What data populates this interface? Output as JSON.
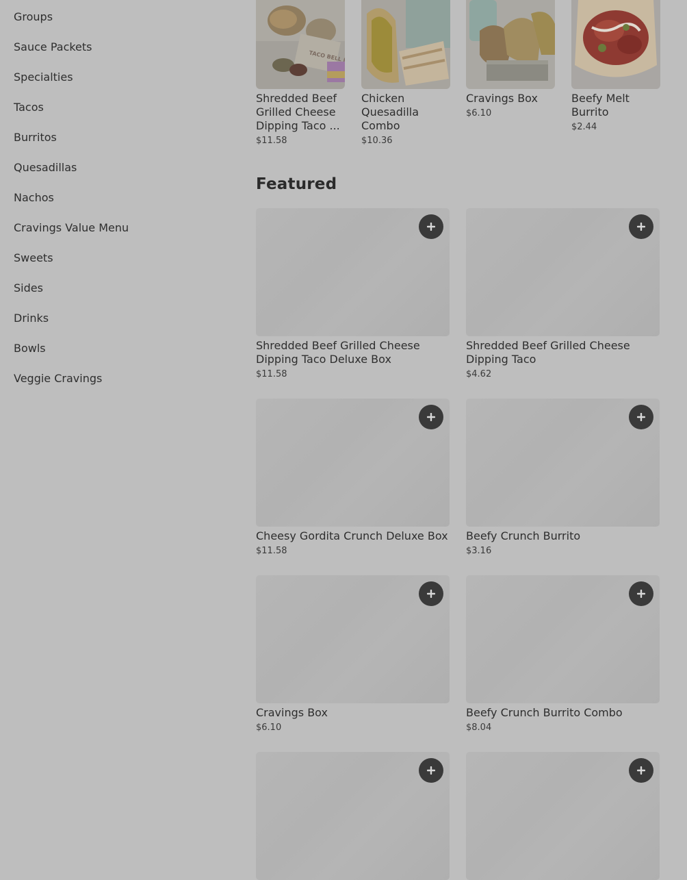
{
  "sidebar": {
    "items": [
      {
        "label": "Groups"
      },
      {
        "label": "Sauce Packets"
      },
      {
        "label": "Specialties"
      },
      {
        "label": "Tacos"
      },
      {
        "label": "Burritos"
      },
      {
        "label": "Quesadillas"
      },
      {
        "label": "Nachos"
      },
      {
        "label": "Cravings Value Menu"
      },
      {
        "label": "Sweets"
      },
      {
        "label": "Sides"
      },
      {
        "label": "Drinks"
      },
      {
        "label": "Bowls"
      },
      {
        "label": "Veggie Cravings"
      }
    ]
  },
  "top_row": [
    {
      "title": "Shredded Beef Grilled Cheese Dipping Taco ...",
      "price": "$11.58",
      "image_text": "TACO BELL REWARDS"
    },
    {
      "title": "Chicken Quesadilla Combo",
      "price": "$10.36"
    },
    {
      "title": "Cravings Box",
      "price": "$6.10"
    },
    {
      "title": "Beefy Melt Burrito",
      "price": "$2.44"
    }
  ],
  "featured": {
    "heading": "Featured",
    "add_icon": "plus-icon",
    "items": [
      {
        "title": "Shredded Beef Grilled Cheese Dipping Taco Deluxe Box",
        "price": "$11.58"
      },
      {
        "title": "Shredded Beef Grilled Cheese Dipping Taco",
        "price": "$4.62"
      },
      {
        "title": "Cheesy Gordita Crunch Deluxe Box",
        "price": "$11.58"
      },
      {
        "title": "Beefy Crunch Burrito",
        "price": "$3.16"
      },
      {
        "title": "Cravings Box",
        "price": "$6.10"
      },
      {
        "title": "Beefy Crunch Burrito Combo",
        "price": "$8.04"
      }
    ]
  },
  "colors": {
    "overlay_bg": "#bebebe",
    "add_button": "#3a3a3a",
    "placeholder": "#b4b4b4"
  }
}
